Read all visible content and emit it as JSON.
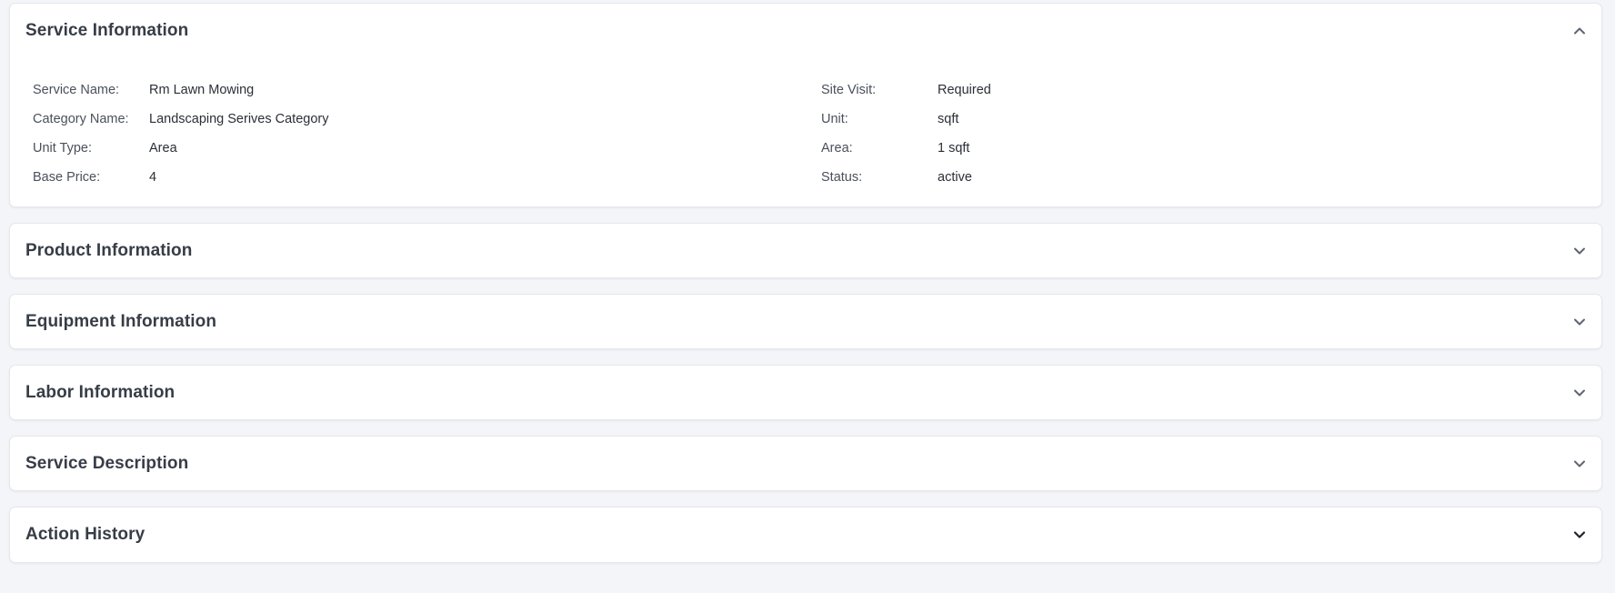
{
  "service_info": {
    "title": "Service Information",
    "expanded": true,
    "left_fields": [
      {
        "label": "Service Name:",
        "value": "Rm Lawn Mowing"
      },
      {
        "label": "Category Name:",
        "value": "Landscaping Serives Category"
      },
      {
        "label": "Unit Type:",
        "value": "Area"
      },
      {
        "label": "Base Price:",
        "value": "4"
      }
    ],
    "right_fields": [
      {
        "label": "Site Visit:",
        "value": "Required"
      },
      {
        "label": "Unit:",
        "value": "sqft"
      },
      {
        "label": "Area:",
        "value": "1 sqft"
      },
      {
        "label": "Status:",
        "value": "active"
      }
    ],
    "toggle_icon": "chevron-up-icon"
  },
  "sections": [
    {
      "title": "Product Information",
      "expanded": false,
      "toggle_icon": "chevron-down-icon"
    },
    {
      "title": "Equipment Information",
      "expanded": false,
      "toggle_icon": "chevron-down-icon"
    },
    {
      "title": "Labor Information",
      "expanded": false,
      "toggle_icon": "chevron-down-icon"
    },
    {
      "title": "Service Description",
      "expanded": false,
      "toggle_icon": "chevron-down-icon"
    },
    {
      "title": "Action History",
      "expanded": false,
      "toggle_icon": "chevron-down-icon"
    }
  ],
  "colors": {
    "page_background": "#f4f5f8",
    "panel_background": "#ffffff",
    "panel_border": "#e4e7ec",
    "title_text": "#373d47",
    "chevron": "#5f6570"
  }
}
